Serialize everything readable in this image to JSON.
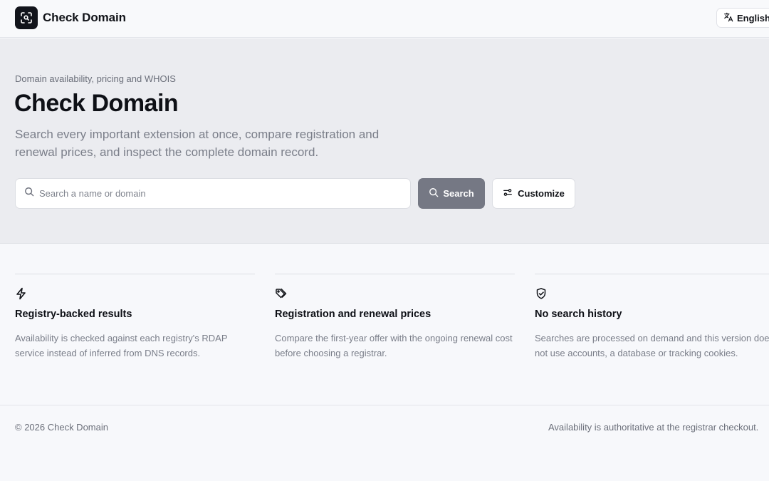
{
  "header": {
    "brand": "Check Domain",
    "language_label": "English",
    "logo_icon": "scan-search-icon",
    "language_icon": "translate-icon"
  },
  "hero": {
    "eyebrow": "Domain availability, pricing and WHOIS",
    "title": "Check Domain",
    "description": "Search every important extension at once, compare registration and renewal prices, and inspect the complete domain record.",
    "search_placeholder": "Search a name or domain",
    "search_value": "",
    "search_button": "Search",
    "customize_button": "Customize"
  },
  "features": [
    {
      "icon": "lightning-icon",
      "title": "Registry-backed results",
      "text": "Availability is checked against each registry's RDAP service instead of inferred from DNS records."
    },
    {
      "icon": "tags-icon",
      "title": "Registration and renewal prices",
      "text": "Compare the first-year offer with the ongoing renewal cost before choosing a registrar."
    },
    {
      "icon": "shield-check-icon",
      "title": "No search history",
      "text": "Searches are processed on demand and this version does not use accounts, a database or tracking cookies."
    }
  ],
  "footer": {
    "copyright": "© 2026 Check Domain",
    "note": "Availability is authoritative at the registrar checkout."
  },
  "colors": {
    "page_bg": "#f7f8fb",
    "hero_bg": "#ebecf0",
    "logo_bg": "#12141b",
    "search_button_bg": "#757884",
    "text_primary": "#0e1016",
    "text_muted": "#7a7e89"
  }
}
